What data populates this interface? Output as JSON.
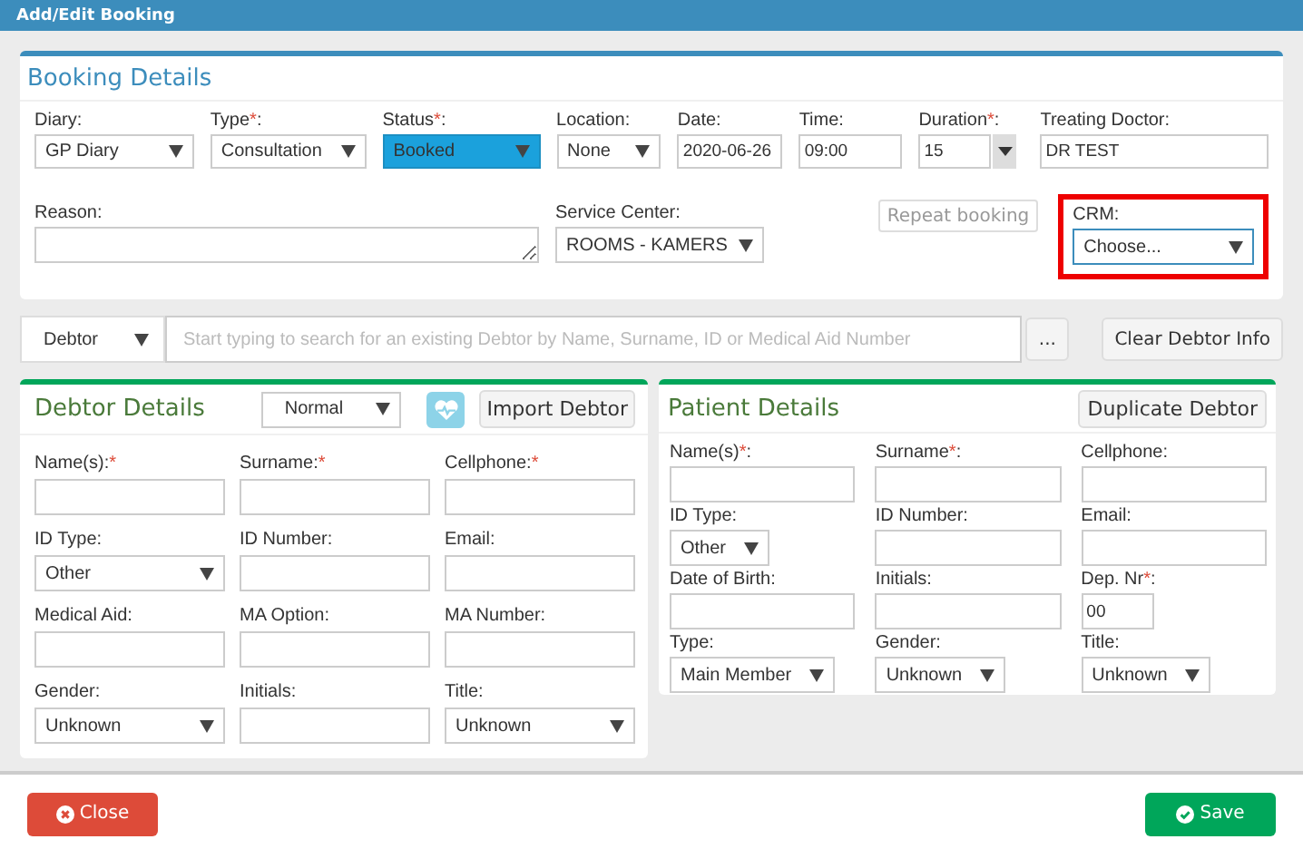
{
  "window": {
    "title": "Add/Edit Booking"
  },
  "booking": {
    "title": "Booking Details",
    "row1": [
      {
        "kind": "select",
        "label": "Diary:",
        "value": "GP Diary"
      },
      {
        "kind": "select",
        "label": "Type",
        "required_mark": "*",
        "label_after": ":",
        "value": "Consultation"
      },
      {
        "kind": "select",
        "label": "Status",
        "required_mark": "*",
        "label_after": ":",
        "value": "Booked",
        "color": "#1ba1dc"
      },
      {
        "kind": "select",
        "label": "Location:",
        "value": "None"
      },
      {
        "kind": "text",
        "label": "Date:",
        "value": "2020-06-26"
      },
      {
        "kind": "text",
        "label": "Time:",
        "value": "09:00"
      },
      {
        "kind": "combo",
        "label": "Duration",
        "required_mark": "*",
        "label_after": ":",
        "value": "15"
      },
      {
        "kind": "text",
        "label": "Treating Doctor:",
        "value": "DR TEST"
      }
    ],
    "row2": [
      {
        "kind": "textarea",
        "label": "Reason:"
      },
      {
        "kind": "select",
        "label": "Service Center:",
        "value": "ROOMS - KAMERS"
      },
      {
        "kind": "button",
        "label": "Repeat booking",
        "disabled": true
      },
      {
        "kind": "select",
        "label": "CRM:",
        "value": "Choose...",
        "highlighted": true
      }
    ]
  },
  "debtor_bar": {
    "mode": "Debtor",
    "search_placeholder": "Start typing to search for an existing Debtor by Name, Surname, ID or Medical Aid Number",
    "more_button": "...",
    "clear_button": "Clear Debtor Info"
  },
  "debtor": {
    "title": "Debtor Details",
    "type_select": "Normal",
    "import_button": "Import Debtor",
    "fields": [
      {
        "kind": "text",
        "label": "Name(s):",
        "required_mark": "*"
      },
      {
        "kind": "text",
        "label": "Surname:",
        "required_mark": "*"
      },
      {
        "kind": "text",
        "label": "Cellphone:",
        "required_mark": "*"
      },
      {
        "kind": "select",
        "label": "ID Type:",
        "value": "Other"
      },
      {
        "kind": "text",
        "label": "ID Number:"
      },
      {
        "kind": "text",
        "label": "Email:"
      },
      {
        "kind": "text",
        "label": "Medical Aid:"
      },
      {
        "kind": "text",
        "label": "MA Option:"
      },
      {
        "kind": "text",
        "label": "MA Number:"
      },
      {
        "kind": "select",
        "label": "Gender:",
        "value": "Unknown"
      },
      {
        "kind": "text",
        "label": "Initials:"
      },
      {
        "kind": "select",
        "label": "Title:",
        "value": "Unknown"
      }
    ]
  },
  "patient": {
    "title": "Patient Details",
    "duplicate_button": "Duplicate Debtor",
    "fields": [
      {
        "kind": "text",
        "label": "Name(s)",
        "required_mark": "*",
        "label_after": ":"
      },
      {
        "kind": "text",
        "label": "Surname",
        "required_mark": "*",
        "label_after": ":"
      },
      {
        "kind": "text",
        "label": "Cellphone:"
      },
      {
        "kind": "select",
        "label": "ID Type:",
        "value": "Other"
      },
      {
        "kind": "text",
        "label": "ID Number:"
      },
      {
        "kind": "text",
        "label": "Email:"
      },
      {
        "kind": "text",
        "label": "Date of Birth:"
      },
      {
        "kind": "text",
        "label": "Initials:"
      },
      {
        "kind": "text",
        "label": "Dep. Nr",
        "required_mark": "*",
        "label_after": ":",
        "value": "00"
      },
      {
        "kind": "select",
        "label": "Type:",
        "value": "Main Member"
      },
      {
        "kind": "select",
        "label": "Gender:",
        "value": "Unknown"
      },
      {
        "kind": "select",
        "label": "Title:",
        "value": "Unknown"
      }
    ]
  },
  "footer": {
    "close_button": "Close",
    "save_button": "Save"
  }
}
